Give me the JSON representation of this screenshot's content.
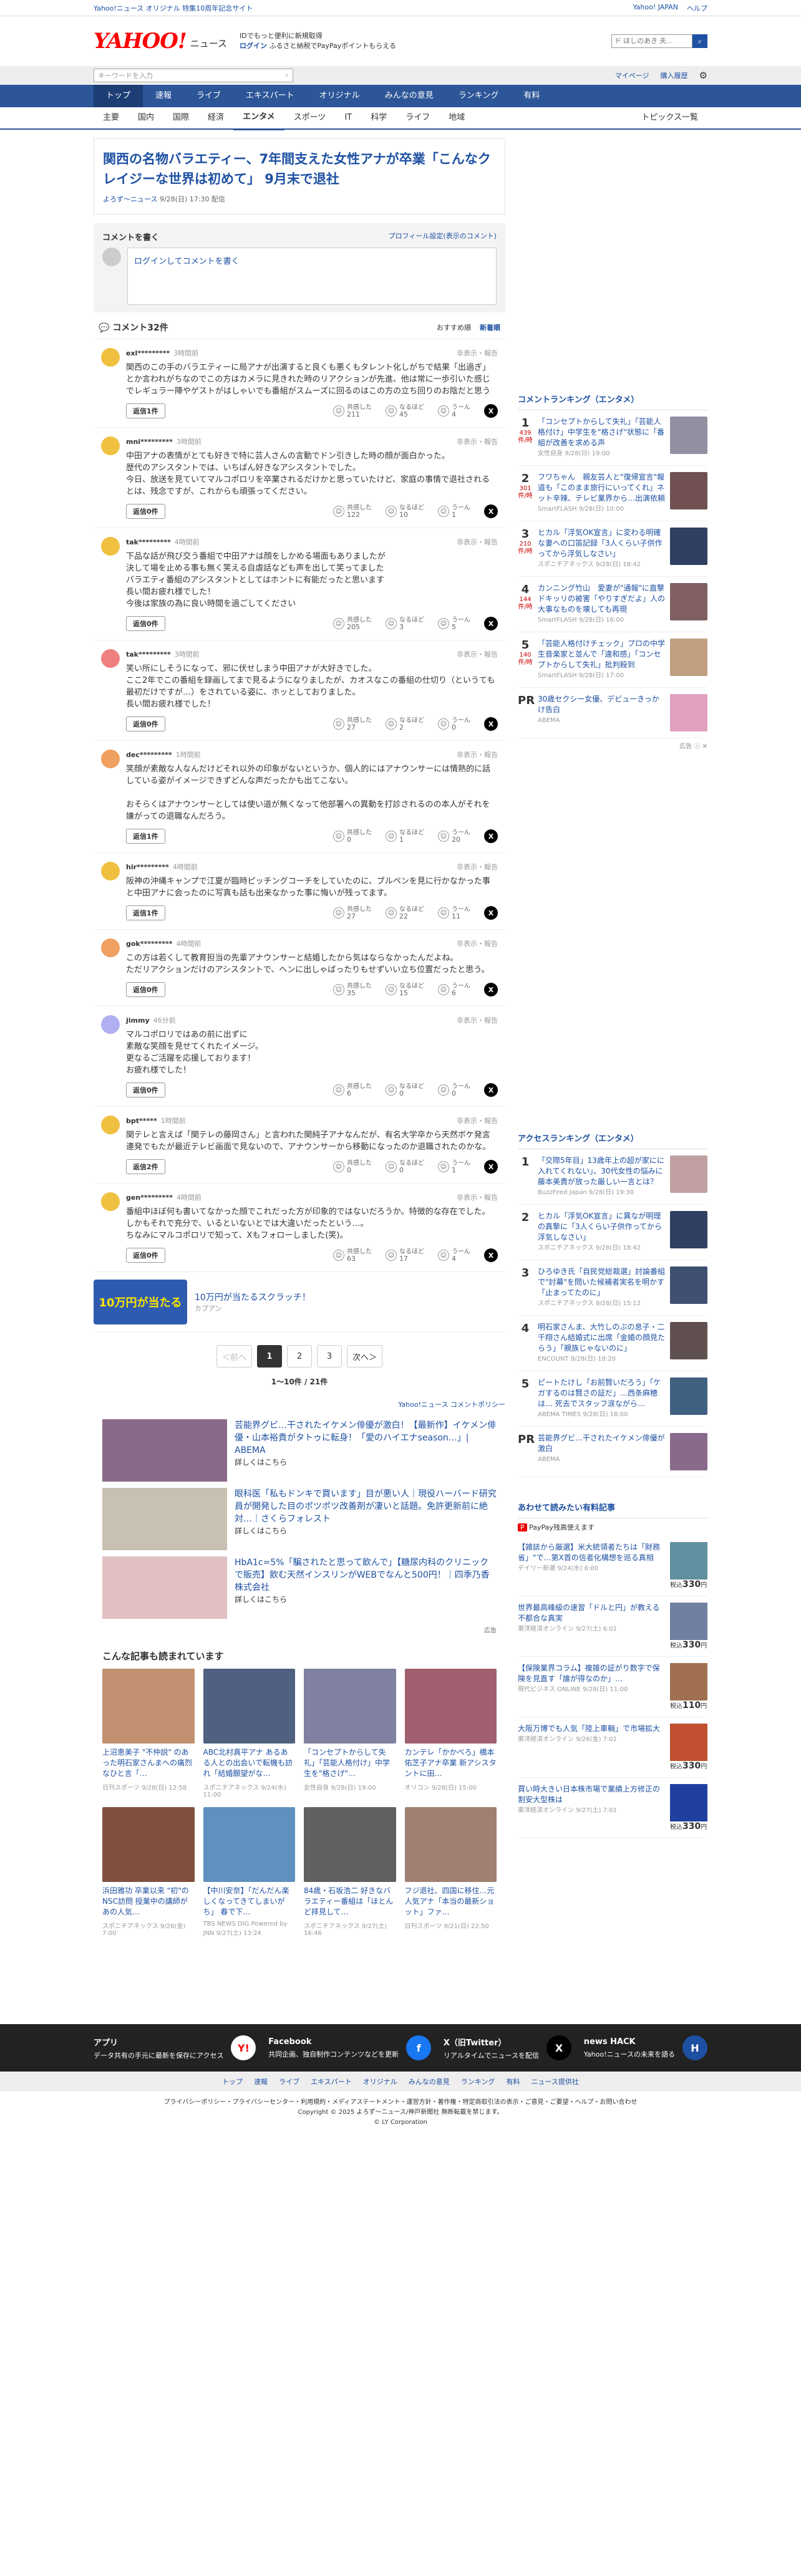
{
  "topbar": {
    "left": "Yahoo!ニュース オリジナル 特集10周年記念サイト",
    "right": [
      "Yahoo! JAPAN",
      "ヘルプ"
    ]
  },
  "header": {
    "logo_main": "YAHOO!",
    "logo_sub": "JAPAN",
    "logo_news": "ニュース",
    "promo_line1": "IDでもっと便利に新規取得",
    "promo_login": "ログイン",
    "promo_line2": "ふるさと納税でPayPayポイントもらえる",
    "search_placeholder": "ウェブ検索",
    "search_value": "ド ほしのあき 夫...",
    "search_icon": "search-icon"
  },
  "subbar": {
    "search_placeholder": "キーワードを入力",
    "mypage": "マイページ",
    "notice": "購入履歴",
    "settings_icon": "gear-icon"
  },
  "nav_primary": [
    "トップ",
    "速報",
    "ライブ",
    "エキスパート",
    "オリジナル",
    "みんなの意見",
    "ランキング",
    "有料"
  ],
  "nav_secondary": [
    "主要",
    "国内",
    "国際",
    "経済",
    "エンタメ",
    "スポーツ",
    "IT",
    "科学",
    "ライフ",
    "地域"
  ],
  "nav_secondary_right": "トピックス一覧",
  "article": {
    "title": "関西の名物バラエティー、7年間支えた女性アナが卒業「こんなクレイジーな世界は初めて」 9月末で退社",
    "source": "よろず～ニュース",
    "date": "9/28(日) 17:30 配信"
  },
  "comment_box": {
    "heading": "コメントを書く",
    "profile_link": "プロフィール設定(表示のコメント)",
    "login_text": "ログインしてコメントを書く"
  },
  "comments_header": {
    "label": "コメント32件",
    "sort_recommended": "おすすめ順",
    "sort_new": "新着順"
  },
  "comments": [
    {
      "user": "exl*********",
      "time": "3時間前",
      "report": "非表示・報告",
      "avatar": "#f0c040",
      "text": "関西のこの手のバラエティーに局アナが出演すると良くも悪くもタレント化しがちで結果「出過ぎ」とか言われがちなのでこの方はカメラに見きれた時のリアクションが先進、他は常に一歩引いた感じでレギュラー陣やゲストがはしゃいでも番組がスムーズに回るのはこの方の立ち回りのお陰だと思う",
      "reply": "返信1件",
      "r1": "211",
      "r2": "45",
      "r3": "4"
    },
    {
      "user": "mni*********",
      "time": "3時間前",
      "report": "非表示・報告",
      "avatar": "#f0c040",
      "text": "中田アナの表情がとても好きで特に芸人さんの言動でドン引きした時の顔が面白かった。\n歴代のアシスタントでは、いちばん好きなアシスタントでした。\n今日、放送を見ていてマルコポロリを卒業されるだけかと思っていたけど、家庭の事情で退社されるとは、残念ですが、これからも頑張ってください。",
      "reply": "返信0件",
      "r1": "122",
      "r2": "10",
      "r3": "1"
    },
    {
      "user": "tak*********",
      "time": "4時間前",
      "report": "非表示・報告",
      "avatar": "#f0c040",
      "text": "下品な話が飛び交う番組で中田アナは顔をしかめる場面もありましたが\n決して場を止める事も無く笑える自虐話なども声を出して笑ってました\nバラエティ番組のアシスタントとしてはホントに有能だったと思います\n長い間お疲れ様でした！\n今後は家族の為に良い時間を過ごしてください",
      "reply": "返信0件",
      "r1": "205",
      "r2": "3",
      "r3": "5"
    },
    {
      "user": "tak*********",
      "time": "3時間前",
      "report": "非表示・報告",
      "avatar": "#f08080",
      "text": "笑い所にしそうになって、邪に伏せしまう中田アナが大好きでした。\nここ2年でこの番組を録画してまで見るようになりましたが、カオスなこの番組の仕切り（というても最初だけですが…）をされている姿に、ホッとしておりました。\n長い間お疲れ様でした！",
      "reply": "返信0件",
      "r1": "27",
      "r2": "2",
      "r3": "0"
    },
    {
      "user": "dec*********",
      "time": "1時間前",
      "report": "非表示・報告",
      "avatar": "#f0a060",
      "text": "笑顔が素敵な人なんだけどそれ以外の印象がないというか、個人的にはアナウンサーには情熱的に話している姿がイメージできずどんな声だったかも出てこない。\n\nおそらくはアナウンサーとしては使い道が無くなって他部署への異動を打診されるのの本人がそれを嫌がっての退職なんだろう。",
      "reply": "返信1件",
      "r1": "0",
      "r2": "1",
      "r3": "20"
    },
    {
      "user": "hir*********",
      "time": "4時間前",
      "report": "非表示・報告",
      "avatar": "#f0c040",
      "text": "阪神の沖縄キャンプで江夏が臨時ピッチングコーチをしていたのに、ブルペンを見に行かなかった事と中田アナに会ったのに写真も話も出来なかった事に悔いが残ってます。",
      "reply": "返信1件",
      "r1": "27",
      "r2": "22",
      "r3": "11"
    },
    {
      "user": "gok*********",
      "time": "4時間前",
      "report": "非表示・報告",
      "avatar": "#f0a060",
      "text": "この方は若くして教育担当の先輩アナウンサーと結婚したから気はならなかったんだよね。\nただリアクションだけのアシスタントで、ヘンに出しゃばったりもせずいい立ち位置だったと思う。",
      "reply": "返信0件",
      "r1": "35",
      "r2": "15",
      "r3": "6"
    },
    {
      "user": "jimmy",
      "time": "46分前",
      "report": "非表示・報告",
      "avatar": "#b0b0f0",
      "text": "マルコポロリではあの前に出ずに\n素敵な笑顔を見せてくれたイメージ。\n更なるご活躍を応援しております！\nお疲れ様でした！",
      "reply": "返信0件",
      "r1": "6",
      "r2": "0",
      "r3": "0"
    },
    {
      "user": "bpt*****",
      "time": "1時間前",
      "report": "非表示・報告",
      "avatar": "#f0c040",
      "text": "関テレと言えば「関テレの藤岡さん」と言われた関純子アナなんだが、有名大学卒から天然ボケ発言連発でもたが最近テレビ画面で見ないので、アナウンサーから移動になったのか退職されたのかな。",
      "reply": "返信2件",
      "r1": "0",
      "r2": "0",
      "r3": "1"
    },
    {
      "user": "gen*********",
      "time": "4時間前",
      "report": "非表示・報告",
      "avatar": "#f0c040",
      "text": "番組中ほぼ何も書いてなかった顔でこれだった方が印象的ではないだろうか。特徴的な存在でした。\nしかもそれで充分で、いるといないとでは大違いだったという…。\nちなみにマルコポロリで知って、Xもフォローしました(笑)。",
      "reply": "返信0件",
      "r1": "63",
      "r2": "17",
      "r3": "4"
    }
  ],
  "ad_scratch": {
    "img_text": "10万円が当たる",
    "text": "10万円が当たるスクラッチ！",
    "sub": "カブアン"
  },
  "pagination": {
    "prev": "＜前へ",
    "pages": [
      "1",
      "2",
      "3"
    ],
    "next": "次へ＞",
    "info": "1〜10件 / 21件"
  },
  "policy_link": "Yahoo!ニュース コメントポリシー",
  "ads": [
    {
      "title": "芸能界グビ…干されたイケメン俳優が激白！【最新作】イケメン俳優・山本裕貴がタトゥに転身！「愛のハイエナseason…」| ABEMA",
      "link": "詳しくはこちら",
      "color": "#8a6a8a"
    },
    {
      "title": "眼科医「私もドンキで買います」目が悪い人｜現役ハーバード研究員が開発した目のポツポツ改善剤が凄いと話題。免許更新前に絶対…｜さくらフォレスト",
      "link": "詳しくはこちら",
      "color": "#c8c0b0"
    },
    {
      "title": "HbA1c=5%「騙されたと思って飲んで」【糖尿内科のクリニックで販売】飲む天然インスリンがWEBでなんと500円！｜四季乃香株式会社",
      "link": "詳しくはこちら",
      "color": "#e0c0c0"
    }
  ],
  "ads_footer": "広告",
  "recommend": {
    "heading": "こんな記事も読まれています",
    "items": [
      {
        "title": "上沼恵美子 \"不仲説\" のあった明石家さんまへの痛烈なひと言「…",
        "source": "日刊スポーツ",
        "date": "9/28(日) 12:58",
        "color": "#c09070"
      },
      {
        "title": "ABC北村真平アナ あるある人との出会いで転機も訪れ「結婚願望がな…",
        "source": "スポニチアネックス",
        "date": "9/24(水) 11:00",
        "color": "#506080"
      },
      {
        "title": "「コンセプトからして失礼」「芸能人格付け」中学生を\"格さげ\"…",
        "source": "女性自身",
        "date": "9/28(日) 19:00",
        "color": "#8080a0"
      },
      {
        "title": "カンテレ「かかべろ」橋本佑芝子アナ卒業 新アシスタントに田…",
        "source": "オリコン",
        "date": "9/28(日) 15:00",
        "color": "#a06070"
      },
      {
        "title": "浜田雅功 卒業以来 \"初\"のNSC訪問 授業中の講師があの人気…",
        "source": "スポニチアネックス",
        "date": "9/26(金) 7:00",
        "color": "#805040"
      },
      {
        "title": "【中川安奈】「だんだん楽しくなってきてしまいがち」 春で下…",
        "source": "TBS NEWS DIG Powered by JNN",
        "date": "9/27(土) 13:24",
        "color": "#6090c0"
      },
      {
        "title": "84歳・石坂浩二 好きなバラエティー番組は「ほとんど拝見して…",
        "source": "スポニチアネックス",
        "date": "9/27(土) 16:46",
        "color": "#606060"
      },
      {
        "title": "フジ退社、四国に移住…元人気アナ「本当の最新ショット」ファ…",
        "source": "日刊スポーツ",
        "date": "9/21(日) 22:50",
        "color": "#a08070"
      }
    ]
  },
  "side_comment_ranking": {
    "heading": "コメントランキング（エンタメ）",
    "items": [
      {
        "rank": "1",
        "count": "439",
        "unit": "件/時",
        "title": "「コンセプトからして失礼」「芸能人格付け」中学生を\"格さげ\"状態に「番組が改善を求める声",
        "source": "女性自身",
        "date": "9/28(日) 19:00",
        "color": "#9090a0"
      },
      {
        "rank": "2",
        "count": "301",
        "unit": "件/時",
        "title": "フワちゃん　親友芸人と\"復帰宣言\"報道も「このまま旅行にいってくれ」ネット辛辣、テレビ業界から…出演依頼",
        "source": "SmartFLASH",
        "date": "9/28(日) 10:00",
        "color": "#705050"
      },
      {
        "rank": "3",
        "count": "210",
        "unit": "件/時",
        "title": "ヒカル「浮気OK宣言」に変わる明確な妻への口笛記録「3人くらい子供作ってから浮気しなさい」",
        "source": "スポニチアネックス",
        "date": "9/28(日) 18:42",
        "color": "#304060"
      },
      {
        "rank": "4",
        "count": "144",
        "unit": "件/時",
        "title": "カンニング竹山　愛妻が\"通報\"に直撃ドキッリの被害「やりすぎだよ」人の大事なものを壊しても再現",
        "source": "SmartFLASH",
        "date": "9/28(日) 16:00",
        "color": "#806060"
      },
      {
        "rank": "5",
        "count": "140",
        "unit": "件/時",
        "title": "「芸能人格付けチェック」プロの中学生音楽家と並んで「違和感」「コンセプトからして失礼」批判殺到",
        "source": "SmartFLASH",
        "date": "9/28(日) 17:00",
        "color": "#c0a080"
      },
      {
        "rank": "PR",
        "count": "",
        "unit": "",
        "title": "30歳セクシー女優、デビューきっかけ告白",
        "source": "ABEMA",
        "date": "",
        "color": "#e0a0c0"
      }
    ]
  },
  "side_access_ranking": {
    "heading": "アクセスランキング（エンタメ）",
    "items": [
      {
        "rank": "1",
        "title": "「交際5年目」13歳年上の超が家にに入れてくれない」、30代女性の悩みに藤本美貴が放った厳しい一言とは？",
        "source": "BuzzFeed Japan",
        "date": "9/28(日) 19:30",
        "color": "#c0a0a0"
      },
      {
        "rank": "2",
        "title": "ヒカル「浮気OK宣言」に異なが明理の真摯に「3人くらい子供作ってから浮気しなさい」",
        "source": "スポニチアネックス",
        "date": "9/28(日) 18:42",
        "color": "#304060"
      },
      {
        "rank": "3",
        "title": "ひろゆき氏「自民党総裁選」討論番組で\"討幕\"を問いた候補者実名を明かす「止まってたのに」",
        "source": "スポニチアネックス",
        "date": "9/28(日) 15:12",
        "color": "#405070"
      },
      {
        "rank": "4",
        "title": "明石家さんま、大竹しのぶの息子・二千翔さん結婚式に出席「金婚の顔見たらう」「親族じゃないのに」",
        "source": "ENCOUNT",
        "date": "9/28(日) 18:20",
        "color": "#605050"
      },
      {
        "rank": "5",
        "title": "ピートたけし「お前賢いだろう」「ケガするのは賢さの証だ」…西条麻穂は… 死去でスタッフ涙ながら…",
        "source": "ABEMA TIMES",
        "date": "9/28(日) 18:00",
        "color": "#406080"
      },
      {
        "rank": "PR",
        "title": "芸能界グビ…干されたイケメン俳優が激白",
        "source": "ABEMA",
        "date": "",
        "color": "#8a6a8a"
      }
    ]
  },
  "side_shop": {
    "heading": "あわせて読みたい有料記事",
    "badge": "PayPay残高使えます",
    "items": [
      {
        "title": "【雑誌から厳選】米大統領者たちは「財務省」\"で…第X首の信者化構想を巡る真相",
        "source": "デイリー新潮",
        "date": "9/24(水) 6:00",
        "price": "330",
        "color": "#6090a0"
      },
      {
        "title": "世界最高峰級の速習「ドルと円」が教える不都合な真実",
        "source": "東洋経済オンライン",
        "date": "9/27(土) 6:01",
        "price": "330",
        "color": "#7080a0"
      },
      {
        "title": "【保険業界コラム】複雑の証がり数字で保険を見直す「誰が得なのか」…",
        "source": "現代ビジネス ONLINE",
        "date": "9/28(日) 11:00",
        "price": "110",
        "color": "#a07050"
      },
      {
        "title": "大阪万博でも人気「陸上車輌」で市場拡大",
        "source": "東洋経済オンライン",
        "date": "9/26(金) 7:01",
        "price": "330",
        "color": "#c05030"
      },
      {
        "title": "買い時大きい日本株市場で業績上方修正の割安大型株は",
        "source": "東洋経済オンライン",
        "date": "9/27(土) 7:01",
        "price": "330",
        "color": "#2040a0"
      }
    ],
    "price_prefix": "税込",
    "price_unit": "円"
  },
  "footer": {
    "apps": [
      {
        "name": "アプリ",
        "desc": "データ共有の手元に最新を保存にアクセス",
        "icon": "yahoo-app-icon"
      },
      {
        "name": "Facebook",
        "desc": "共同企画、独自制作コンテンツなどを更新",
        "icon": "facebook-icon"
      },
      {
        "name": "X（旧Twitter）",
        "desc": "リアルタイムでニュースを配信",
        "icon": "x-icon"
      },
      {
        "name": "news HACK",
        "desc": "Yahoo!ニュースの未来を語る",
        "icon": "newshack-icon"
      }
    ],
    "links": [
      "トップ",
      "速報",
      "ライブ",
      "エキスパート",
      "オリジナル",
      "みんなの意見",
      "ランキング",
      "有料",
      "ニュース提供社"
    ],
    "legal": "プライバシーポリシー・プライバシーセンター・利用規約・メディアステートメント・運営方針・著作権・特定商取引法の表示・ご意見・ご要望・ヘルプ・お問い合わせ",
    "copyright": "Copyright © 2025 よろず～ニュース/神戸新聞社 無断転載を禁じます。",
    "copyright2": "© LY Corporation"
  }
}
